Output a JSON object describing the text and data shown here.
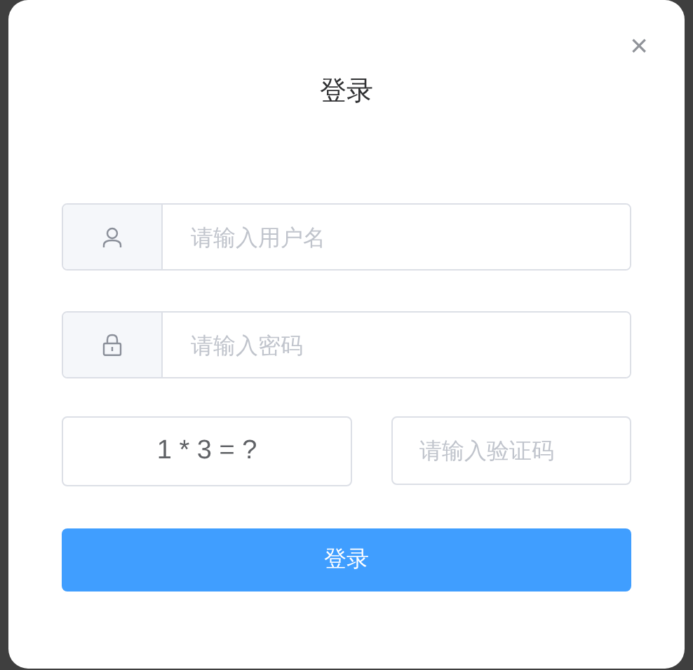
{
  "dialog": {
    "title": "登录",
    "close": "×"
  },
  "fields": [
    {
      "kind": "username",
      "placeholder": "请输入用户名"
    },
    {
      "kind": "password",
      "placeholder": "请输入密码"
    }
  ],
  "captcha": {
    "question": "1 * 3 = ?",
    "placeholder": "请输入验证码"
  },
  "submit": "登录"
}
